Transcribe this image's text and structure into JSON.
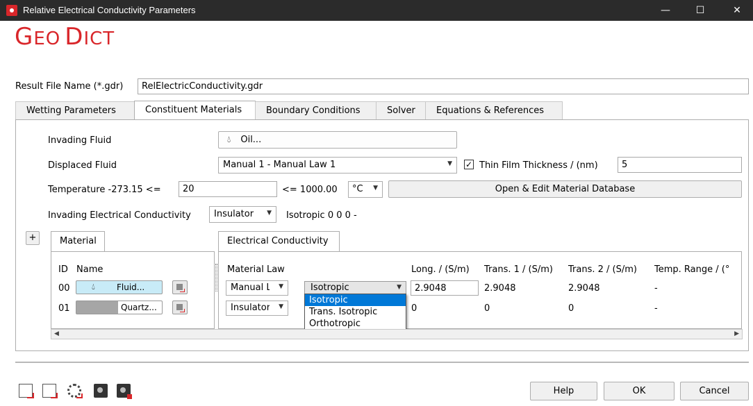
{
  "window": {
    "title": "Relative Electrical Conductivity Parameters",
    "min_glyph": "—",
    "max_glyph": "☐",
    "close_glyph": "✕"
  },
  "logo": {
    "text_big1": "G",
    "text_small1": "EO",
    "text_big2": "D",
    "text_small2": "ICT"
  },
  "result_file": {
    "label": "Result File Name (*.gdr)",
    "value": "RelElectricConductivity.gdr"
  },
  "tabs": [
    {
      "label": "Wetting Parameters"
    },
    {
      "label": "Constituent Materials"
    },
    {
      "label": "Boundary Conditions"
    },
    {
      "label": "Solver"
    },
    {
      "label": "Equations & References"
    }
  ],
  "constituent": {
    "invading_fluid_label": "Invading Fluid",
    "invading_fluid_button": "Oil...",
    "displaced_fluid_label": "Displaced Fluid",
    "displaced_fluid_value": "Manual 1 - Manual Law 1",
    "thin_film_checked": "✓",
    "thin_film_label": "Thin Film Thickness / (nm)",
    "thin_film_value": "5",
    "temperature_label": "Temperature",
    "temperature_min": "-273.15 <=",
    "temperature_value": "20",
    "temperature_max": "<= 1000.00",
    "temperature_unit": "°C",
    "open_db_button": "Open & Edit Material Database",
    "invading_cond_label": "Invading Electrical Conductivity",
    "invading_cond_value": "Insulator",
    "invading_cond_info": "Isotropic 0 0 0 -"
  },
  "plus_button": "+",
  "material_panel": {
    "tab": "Material",
    "col_id": "ID",
    "col_name": "Name",
    "rows": [
      {
        "id": "00",
        "name": "Fluid...",
        "color": "#c8ebf7"
      },
      {
        "id": "01",
        "name": "Quartz...",
        "color": "#a6a6a6"
      }
    ]
  },
  "conductivity_panel": {
    "tab": "Electrical Conductivity",
    "col_law": "Material Law",
    "col_long": "Long. / (S/m)",
    "col_t1": "Trans. 1 / (S/m)",
    "col_t2": "Trans. 2 / (S/m)",
    "col_range": "Temp. Range / (°",
    "rows": [
      {
        "law": "Manual L",
        "type": "Isotropic",
        "long": "2.9048",
        "t1": "2.9048",
        "t2": "2.9048",
        "range": "-"
      },
      {
        "law": "Insulator",
        "long": "0",
        "t1": "0",
        "t2": "0",
        "range": "-"
      }
    ]
  },
  "dropdown_options": [
    "Isotropic",
    "Trans. Isotropic",
    "Orthotropic"
  ],
  "bottom_buttons": {
    "help": "Help",
    "ok": "OK",
    "cancel": "Cancel"
  }
}
